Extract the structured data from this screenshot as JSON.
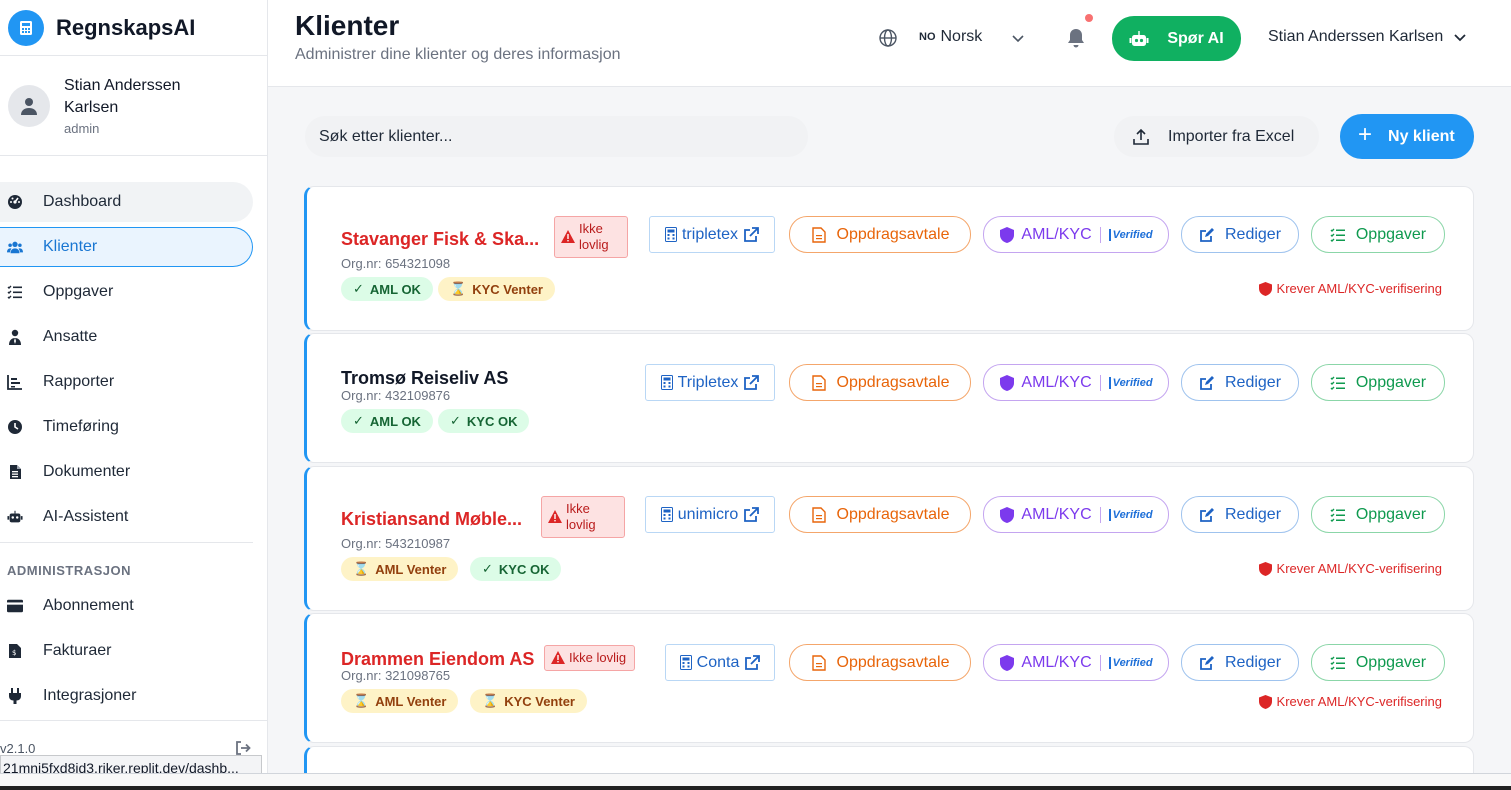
{
  "app": {
    "name": "RegnskapsAI",
    "version": "v2.1.0"
  },
  "user": {
    "name": "Stian Anderssen Karlsen",
    "role": "admin"
  },
  "sidebar": {
    "items": [
      {
        "label": "Dashboard",
        "icon": "dashboard-icon"
      },
      {
        "label": "Klienter",
        "icon": "users-icon",
        "active": true
      },
      {
        "label": "Oppgaver",
        "icon": "tasks-icon"
      },
      {
        "label": "Ansatte",
        "icon": "employee-icon"
      },
      {
        "label": "Rapporter",
        "icon": "chart-icon"
      },
      {
        "label": "Timeføring",
        "icon": "clock-icon"
      },
      {
        "label": "Dokumenter",
        "icon": "document-icon"
      },
      {
        "label": "AI-Assistent",
        "icon": "robot-icon"
      }
    ],
    "admin_title": "ADMINISTRASJON",
    "admin_items": [
      {
        "label": "Abonnement",
        "icon": "credit-card-icon"
      },
      {
        "label": "Fakturaer",
        "icon": "invoice-icon"
      },
      {
        "label": "Integrasjoner",
        "icon": "plug-icon"
      }
    ]
  },
  "status_url": "21mni5fxd8id3.riker.replit.dev/dashb...",
  "header": {
    "title": "Klienter",
    "subtitle": "Administrer dine klienter og deres informasjon",
    "language_code": "NO",
    "language": "Norsk",
    "ai_button": "Spør AI",
    "user_menu": "Stian Anderssen Karlsen"
  },
  "toolbar": {
    "search_placeholder": "Søk etter klienter...",
    "import_label": "Importer fra Excel",
    "new_label": "Ny klient"
  },
  "labels": {
    "illegal": "Ikke lovlig",
    "agreement": "Oppdragsavtale",
    "aml_kyc": "AML/KYC",
    "verified": "Verified",
    "edit": "Rediger",
    "tasks": "Oppgaver",
    "aml_required": "Krever AML/KYC-verifisering"
  },
  "clients": [
    {
      "name": "Stavanger Fisk & Ska...",
      "orgnr": "Org.nr: 654321098",
      "legal": false,
      "integration": "tripletex",
      "aml": "AML OK",
      "kyc": "KYC Venter",
      "aml_ok": true,
      "kyc_ok": false
    },
    {
      "name": "Tromsø Reiseliv AS",
      "orgnr": "Org.nr: 432109876",
      "legal": true,
      "integration": "Tripletex",
      "aml": "AML OK",
      "kyc": "KYC OK",
      "aml_ok": true,
      "kyc_ok": true
    },
    {
      "name": "Kristiansand Møble...",
      "orgnr": "Org.nr: 543210987",
      "legal": false,
      "integration": "unimicro",
      "aml": "AML Venter",
      "kyc": "KYC OK",
      "aml_ok": false,
      "kyc_ok": true
    },
    {
      "name": "Drammen Eiendom AS",
      "orgnr": "Org.nr: 321098765",
      "legal": false,
      "integration": "Conta",
      "aml": "AML Venter",
      "kyc": "KYC Venter",
      "aml_ok": false,
      "kyc_ok": false
    }
  ],
  "colors": {
    "accent": "#2196f3",
    "ai_green": "#10b061",
    "danger": "#dc2626"
  }
}
